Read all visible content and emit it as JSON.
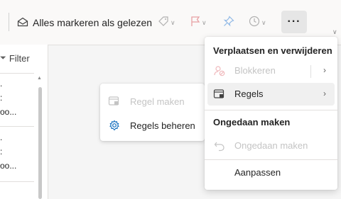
{
  "toolbar": {
    "mark_all_read_label": "Alles markeren als gelezen",
    "more_label": "···"
  },
  "list_pane": {
    "filter_label": "Filter",
    "item1": {
      "line1": ".",
      "line2": ":",
      "line3": "oo..."
    },
    "item2": {
      "line1": ".",
      "line2": ":",
      "line3": "oo..."
    }
  },
  "more_menu": {
    "section_move": "Verplaatsen en verwijderen",
    "block_label": "Blokkeren",
    "rules_label": "Regels",
    "section_undo": "Ongedaan maken",
    "undo_label": "Ongedaan maken",
    "customize_label": "Aanpassen"
  },
  "rules_submenu": {
    "create_rule_label": "Regel maken",
    "manage_rules_label": "Regels beheren"
  },
  "colors": {
    "accent": "#0f6cbd",
    "flag": "#d13438",
    "disabled": "#c4c4c4"
  }
}
